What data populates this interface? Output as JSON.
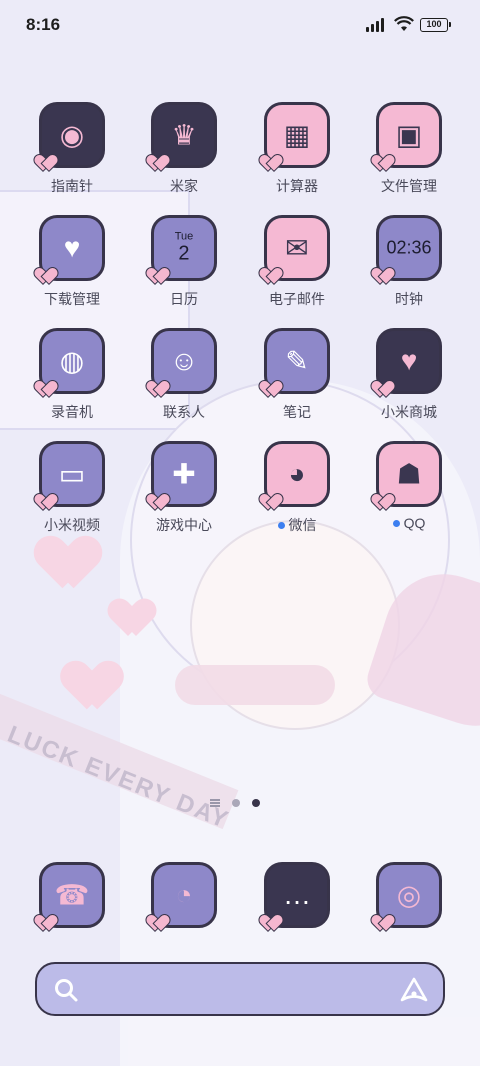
{
  "status_bar": {
    "time": "8:16",
    "battery": "100"
  },
  "apps": [
    {
      "label": "指南针",
      "icon": "compass-icon",
      "bg": "#3a3650",
      "glyph": "◉"
    },
    {
      "label": "米家",
      "icon": "mijia-icon",
      "bg": "#3a3650",
      "glyph": "♛"
    },
    {
      "label": "计算器",
      "icon": "calculator-icon",
      "bg": "#f5b9d3",
      "glyph": "▦"
    },
    {
      "label": "文件管理",
      "icon": "files-icon",
      "bg": "#f5b9d3",
      "glyph": "▣"
    },
    {
      "label": "下载管理",
      "icon": "downloads-icon",
      "bg": "#8e88c9",
      "glyph": "♥"
    },
    {
      "label": "日历",
      "icon": "calendar-icon",
      "bg": "#8e88c9",
      "calendar_day": "Tue",
      "calendar_date": "2"
    },
    {
      "label": "电子邮件",
      "icon": "mail-icon",
      "bg": "#f5b9d3",
      "glyph": "✉"
    },
    {
      "label": "时钟",
      "icon": "clock-icon",
      "bg": "#8e88c9",
      "clock_text": "02:36"
    },
    {
      "label": "录音机",
      "icon": "recorder-icon",
      "bg": "#8e88c9",
      "glyph": "◍"
    },
    {
      "label": "联系人",
      "icon": "contacts-icon",
      "bg": "#8e88c9",
      "glyph": "☺"
    },
    {
      "label": "笔记",
      "icon": "notes-icon",
      "bg": "#8e88c9",
      "glyph": "✎"
    },
    {
      "label": "小米商城",
      "icon": "mi-store-icon",
      "bg": "#3a3650",
      "glyph": "♥"
    },
    {
      "label": "小米视频",
      "icon": "mi-video-icon",
      "bg": "#8e88c9",
      "glyph": "▭"
    },
    {
      "label": "游戏中心",
      "icon": "game-center-icon",
      "bg": "#8e88c9",
      "glyph": "✚"
    },
    {
      "label": "微信",
      "icon": "wechat-icon",
      "bg": "#f5b9d3",
      "glyph": "◕",
      "dot": true
    },
    {
      "label": "QQ",
      "icon": "qq-icon",
      "bg": "#f5b9d3",
      "glyph": "☗",
      "dot": true
    }
  ],
  "dock": [
    {
      "icon": "phone-icon",
      "bg": "#8e88c9",
      "glyph": "☎"
    },
    {
      "icon": "browser-icon",
      "bg": "#8e88c9",
      "glyph": "◔"
    },
    {
      "icon": "messages-icon",
      "bg": "#3a3650",
      "glyph": "…"
    },
    {
      "icon": "camera-icon",
      "bg": "#8e88c9",
      "glyph": "◎"
    }
  ],
  "wallpaper_text": "LUCK EVERY DAY",
  "page_indicator": {
    "pages": 2,
    "active": 2
  }
}
